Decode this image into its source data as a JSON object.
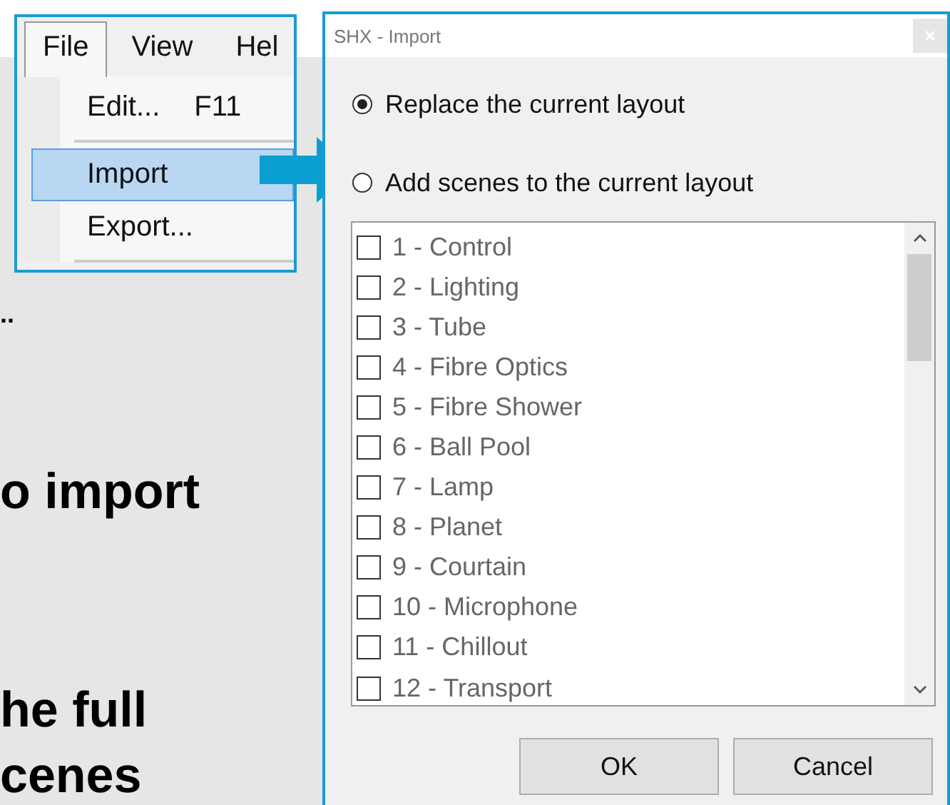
{
  "background_text": [
    "..",
    "o import",
    "he full",
    "cenes"
  ],
  "menu": {
    "menubar": [
      {
        "label": "File",
        "selected": true
      },
      {
        "label": "View",
        "selected": false
      },
      {
        "label": "Hel",
        "selected": false
      }
    ],
    "items": [
      {
        "kind": "item",
        "label": "Edit...",
        "shortcut": "F11",
        "selected": false
      },
      {
        "kind": "separator"
      },
      {
        "kind": "item",
        "label": "Import",
        "selected": true
      },
      {
        "kind": "item",
        "label": "Export...",
        "selected": false
      },
      {
        "kind": "separator"
      }
    ]
  },
  "dialog": {
    "title": "SHX - Import",
    "options": [
      {
        "label": "Replace the current layout",
        "selected": true
      },
      {
        "label": "Add scenes to the current layout",
        "selected": false
      }
    ],
    "scenes": [
      {
        "label": "1 - Control",
        "checked": false
      },
      {
        "label": "2 - Lighting",
        "checked": false
      },
      {
        "label": "3 - Tube",
        "checked": false
      },
      {
        "label": "4 - Fibre Optics",
        "checked": false
      },
      {
        "label": "5 - Fibre Shower",
        "checked": false
      },
      {
        "label": "6 - Ball Pool",
        "checked": false
      },
      {
        "label": "7 - Lamp",
        "checked": false
      },
      {
        "label": "8 - Planet",
        "checked": false
      },
      {
        "label": "9 - Courtain",
        "checked": false
      },
      {
        "label": "10 - Microphone",
        "checked": false
      },
      {
        "label": "11 - Chillout",
        "checked": false
      },
      {
        "label": "12 - Transport",
        "checked": false
      }
    ],
    "buttons": [
      "OK",
      "Cancel"
    ]
  }
}
